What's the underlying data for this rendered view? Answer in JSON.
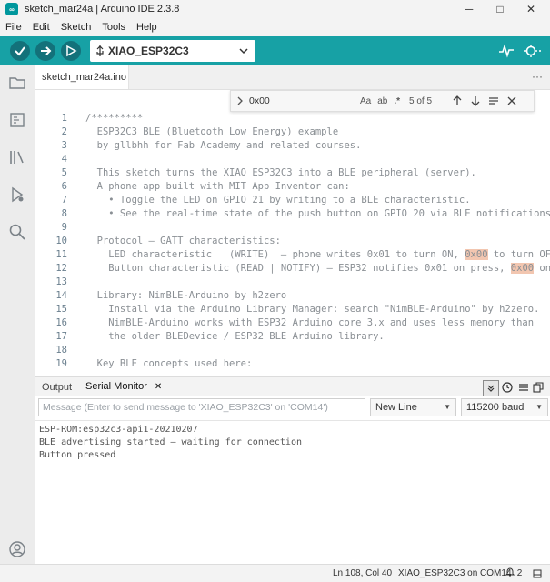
{
  "window": {
    "title": "sketch_mar24a | Arduino IDE 2.3.8",
    "logo_text": "∞",
    "minimize": "─",
    "maximize": "□",
    "close": "✕"
  },
  "menu": [
    "File",
    "Edit",
    "Sketch",
    "Tools",
    "Help"
  ],
  "toolbar": {
    "board": "XIAO_ESP32C3"
  },
  "tab": {
    "filename": "sketch_mar24a.ino",
    "more": "···"
  },
  "find": {
    "value": "0x00",
    "count": "5 of 5",
    "opt_case": "Aa",
    "opt_word": "ab",
    "opt_regex": ".*"
  },
  "editor": {
    "line_numbers": [
      "1",
      "2",
      "3",
      "4",
      "5",
      "6",
      "7",
      "8",
      "9",
      "10",
      "11",
      "12",
      "13",
      "14",
      "15",
      "16",
      "17",
      "18",
      "19"
    ],
    "lines": [
      [
        {
          "t": "/*********"
        }
      ],
      [
        {
          "t": "  ESP32C3 BLE (Bluetooth Low Energy) example"
        }
      ],
      [
        {
          "t": "  by gllbhh for Fab Academy and related courses."
        }
      ],
      [
        {
          "t": ""
        }
      ],
      [
        {
          "t": "  This sketch turns the XIAO ESP32C3 into a BLE peripheral (server)."
        }
      ],
      [
        {
          "t": "  A phone app built with MIT App Inventor can:"
        }
      ],
      [
        {
          "t": "    • Toggle the LED on GPIO 21 by writing to a BLE characteristic."
        }
      ],
      [
        {
          "t": "    • See the real-time state of the push button on GPIO 20 via BLE notifications."
        }
      ],
      [
        {
          "t": ""
        }
      ],
      [
        {
          "t": "  Protocol — GATT characteristics:"
        }
      ],
      [
        {
          "t": "    LED characteristic   (WRITE)  — phone writes 0x01 to turn ON, "
        },
        {
          "t": "0x00",
          "h": true
        },
        {
          "t": " to turn OFF"
        }
      ],
      [
        {
          "t": "    Button characteristic (READ | NOTIFY) — ESP32 notifies 0x01 on press, "
        },
        {
          "t": "0x00",
          "h": true
        },
        {
          "t": " on re"
        }
      ],
      [
        {
          "t": ""
        }
      ],
      [
        {
          "t": "  Library: NimBLE-Arduino by h2zero"
        }
      ],
      [
        {
          "t": "    Install via the Arduino Library Manager: search \"NimBLE-Arduino\" by h2zero."
        }
      ],
      [
        {
          "t": "    NimBLE-Arduino works with ESP32 Arduino core 3.x and uses less memory than"
        }
      ],
      [
        {
          "t": "    the older BLEDevice / ESP32 BLE Arduino library."
        }
      ],
      [
        {
          "t": ""
        }
      ],
      [
        {
          "t": "  Key BLE concepts used here:"
        }
      ]
    ]
  },
  "panel": {
    "tab_output": "Output",
    "tab_serial": "Serial Monitor",
    "close": "✕",
    "placeholder": "Message (Enter to send message to 'XIAO_ESP32C3' on 'COM14')",
    "line_ending": "New Line",
    "baud": "115200 baud",
    "output": [
      "ESP-ROM:esp32c3-api1-20210207",
      "BLE advertising started — waiting for connection",
      "Button pressed"
    ]
  },
  "status": {
    "position": "Ln 108, Col 40",
    "board_port": "XIAO_ESP32C3 on COM14",
    "notifications": "2"
  },
  "colors": {
    "accent": "#17a1a5",
    "highlight": "#f2c6b0"
  }
}
